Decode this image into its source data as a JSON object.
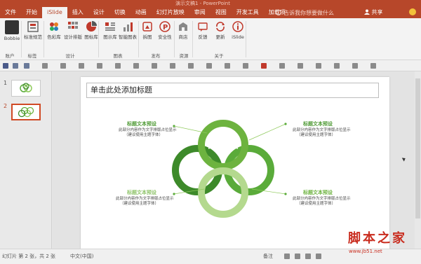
{
  "window": {
    "title": "演示文稿1 - PowerPoint"
  },
  "menu": {
    "tabs": [
      "文件",
      "开始",
      "iSlide",
      "插入",
      "设计",
      "切换",
      "动画",
      "幻灯片放映",
      "审阅",
      "视图",
      "开发工具",
      "加载项"
    ],
    "active_tab": "iSlide",
    "tell_me": "告诉我你想要做什么",
    "share": "共享"
  },
  "ribbon": {
    "buttons": [
      {
        "label": "Bobbie",
        "icon": "user-avatar-icon"
      },
      {
        "label": "标准规范",
        "icon": "standards-icon"
      },
      {
        "label": "色彩库",
        "icon": "color-library-icon"
      },
      {
        "label": "设计排版",
        "icon": "layout-icon"
      },
      {
        "label": "图标库",
        "icon": "icon-library-icon"
      },
      {
        "label": "图示库",
        "icon": "diagram-library-icon"
      },
      {
        "label": "智能图表",
        "icon": "smart-chart-icon"
      },
      {
        "label": "拆图",
        "icon": "split-image-icon"
      },
      {
        "label": "安全性",
        "icon": "security-icon"
      },
      {
        "label": "商店",
        "icon": "store-icon"
      },
      {
        "label": "反馈",
        "icon": "feedback-icon"
      },
      {
        "label": "更新",
        "icon": "update-icon"
      },
      {
        "label": "iSlide",
        "icon": "info-icon"
      }
    ],
    "groups": [
      "账户",
      "标签",
      "设计",
      "图表",
      "发布",
      "资源",
      "关于"
    ]
  },
  "thumbnails": [
    {
      "number": "1"
    },
    {
      "number": "2"
    }
  ],
  "slide": {
    "title_placeholder": "单击此处添加标题",
    "blocks": [
      {
        "title": "标题文本预设",
        "line1": "此部分内容作为文字排版占位显示",
        "line2": "（建议使用主题字体）",
        "color": "#4e9a34"
      },
      {
        "title": "标题文本预设",
        "line1": "此部分内容作为文字排版占位显示",
        "line2": "（建议使用主题字体）",
        "color": "#4e9a34"
      },
      {
        "title": "标题文本预设",
        "line1": "此部分内容作为文字排版占位显示",
        "line2": "（建议使用主题字体）",
        "color": "#8fc46a"
      },
      {
        "title": "标题文本预设",
        "line1": "此部分内容作为文字排版占位显示",
        "line2": "（建议使用主题字体）",
        "color": "#6db33f"
      }
    ],
    "colors": {
      "dark_green": "#3d8a2a",
      "green": "#5aab3a",
      "light_green": "#8fca5c",
      "pale_green": "#b4d98e"
    }
  },
  "status": {
    "slide_counter": "幻灯片 第 2 张，共 2 张",
    "language": "中文(中国)",
    "notes": "备注"
  },
  "watermark": {
    "text": "脚本之家",
    "url": "www.jb51.net"
  },
  "theme": {
    "accent": "#b7472a"
  }
}
